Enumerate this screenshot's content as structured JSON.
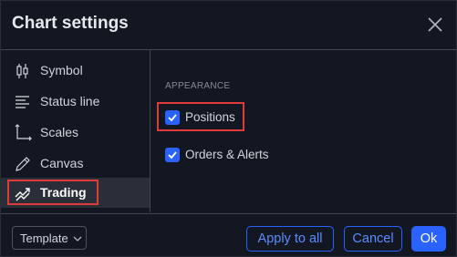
{
  "dialog": {
    "title": "Chart settings"
  },
  "sidebar": {
    "items": [
      {
        "label": "Symbol",
        "icon": "candlestick-icon"
      },
      {
        "label": "Status line",
        "icon": "status-lines-icon"
      },
      {
        "label": "Scales",
        "icon": "scales-axes-icon"
      },
      {
        "label": "Canvas",
        "icon": "pencil-icon"
      },
      {
        "label": "Trading",
        "icon": "trading-chart-icon",
        "active": true
      }
    ]
  },
  "content": {
    "section_title": "APPEARANCE",
    "options": [
      {
        "label": "Positions",
        "checked": true
      },
      {
        "label": "Orders & Alerts",
        "checked": true
      }
    ]
  },
  "footer": {
    "template_label": "Template",
    "apply_all_label": "Apply to all",
    "cancel_label": "Cancel",
    "ok_label": "Ok"
  },
  "colors": {
    "background": "#131722",
    "accent": "#2962ff",
    "highlight": "#e03b3b"
  }
}
